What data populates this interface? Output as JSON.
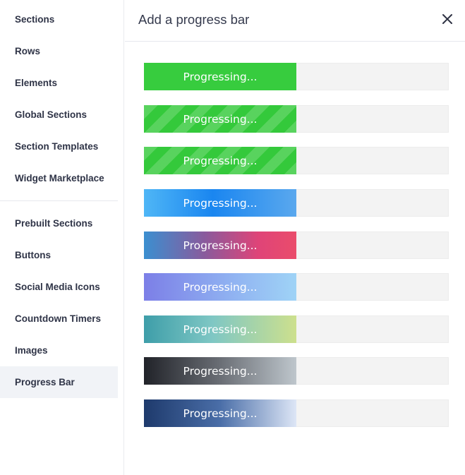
{
  "sidebar": {
    "items": [
      {
        "label": "Sections"
      },
      {
        "label": "Rows"
      },
      {
        "label": "Elements"
      },
      {
        "label": "Global Sections"
      },
      {
        "label": "Section Templates"
      },
      {
        "label": "Widget Marketplace"
      },
      {
        "label": "Prebuilt Sections"
      },
      {
        "label": "Buttons"
      },
      {
        "label": "Social Media Icons"
      },
      {
        "label": "Countdown Timers"
      },
      {
        "label": "Images"
      },
      {
        "label": "Progress Bar",
        "active": true
      }
    ]
  },
  "header": {
    "title": "Add a progress bar",
    "close_icon": "close-icon"
  },
  "bars": [
    {
      "label": "Progressing...",
      "progress": 0.5,
      "style": "solid green"
    },
    {
      "label": "Progressing...",
      "progress": 0.5,
      "style": "striped green"
    },
    {
      "label": "Progressing...",
      "progress": 0.5,
      "style": "striped green"
    },
    {
      "label": "Progressing...",
      "progress": 0.5,
      "style": "blue gradient"
    },
    {
      "label": "Progressing...",
      "progress": 0.5,
      "style": "blue-pink gradient"
    },
    {
      "label": "Progressing...",
      "progress": 0.5,
      "style": "purple-sky gradient"
    },
    {
      "label": "Progressing...",
      "progress": 0.5,
      "style": "teal-lime gradient"
    },
    {
      "label": "Progressing...",
      "progress": 0.5,
      "style": "black-gray gradient"
    },
    {
      "label": "Progressing...",
      "progress": 0.5,
      "style": "navy-white gradient"
    }
  ],
  "colors": {
    "green": "#37cc3e",
    "track": "#f3f3f3",
    "active_item_bg": "#f1f3f7"
  }
}
